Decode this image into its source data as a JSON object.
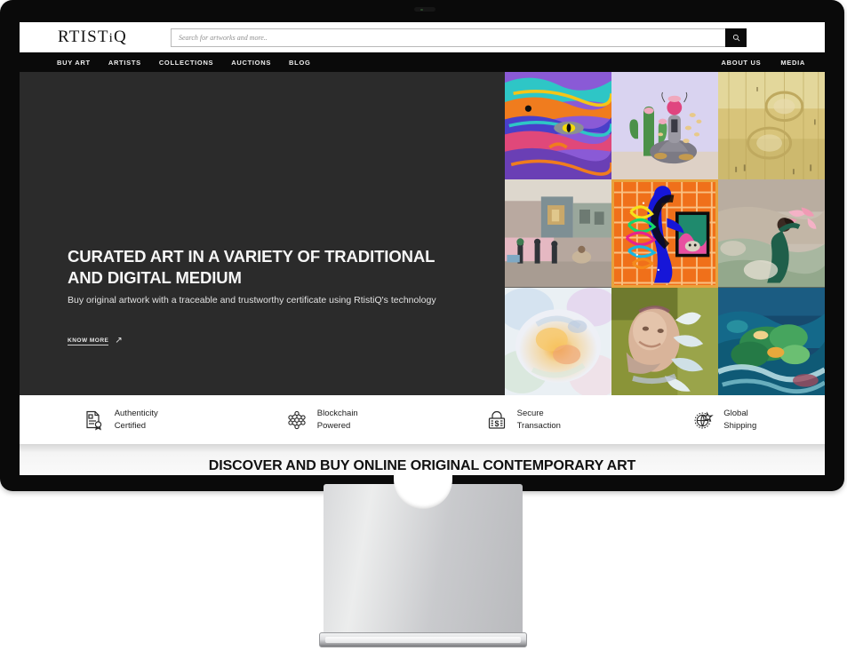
{
  "device": {
    "type": "desktop-monitor",
    "bezel_color": "#0a0a0a",
    "stand_color": "#cfd0d2"
  },
  "header": {
    "logo_main": "RTIST",
    "logo_i": "i",
    "logo_end": "Q",
    "logo_full": "RTISTiQ"
  },
  "search": {
    "placeholder": "Search for artworks and more..",
    "value": "",
    "button_icon": "search-icon"
  },
  "nav": {
    "left_items": [
      {
        "label": "BUY ART"
      },
      {
        "label": "ARTISTS"
      },
      {
        "label": "COLLECTIONS"
      },
      {
        "label": "AUCTIONS"
      },
      {
        "label": "BLOG"
      }
    ],
    "right_items": [
      {
        "label": "ABOUT US"
      },
      {
        "label": "MEDIA"
      }
    ]
  },
  "hero": {
    "background_color": "#2b2b2b",
    "title": "CURATED ART IN A VARIETY OF TRADITIONAL AND DIGITAL MEDIUM",
    "subtitle": "Buy original artwork with a traceable and trustworthy certificate using RtistiQ's technology",
    "cta_label": "KNOW MORE",
    "cta_arrow": "↗"
  },
  "art_grid": {
    "selected_index": 4,
    "selected_border_color": "#e8a33d",
    "tiles": [
      {
        "name": "abstract-psychedelic-cat",
        "alt": "Colorful psychedelic abstract cat face"
      },
      {
        "name": "cactus-figure-painting",
        "alt": "Seated figure with cactus on lilac ground"
      },
      {
        "name": "golden-texture-abstract",
        "alt": "Golden ochre textured abstract with circles"
      },
      {
        "name": "street-scene-photo",
        "alt": "Weathered street scene with figures"
      },
      {
        "name": "orange-grid-blue-figure",
        "alt": "Blue silhouette figure on orange grid"
      },
      {
        "name": "woman-carrying-flowers",
        "alt": "Woman in green dress carrying pink flowers"
      },
      {
        "name": "pastel-floral-abstract",
        "alt": "Soft pastel floral abstract"
      },
      {
        "name": "portrait-green-abstract",
        "alt": "Abstract portrait on olive green"
      },
      {
        "name": "teal-underwater-abstract",
        "alt": "Teal underwater abstract landscape"
      }
    ]
  },
  "features": [
    {
      "icon": "certificate-document-icon",
      "line1": "Authenticity",
      "line2": "Certified"
    },
    {
      "icon": "blockchain-network-icon",
      "line1": "Blockchain",
      "line2": "Powered"
    },
    {
      "icon": "padlock-dollar-icon",
      "line1": "Secure",
      "line2": "Transaction"
    },
    {
      "icon": "globe-airplane-icon",
      "line1": "Global",
      "line2": "Shipping"
    }
  ],
  "lower_section": {
    "title": "DISCOVER AND BUY ONLINE ORIGINAL CONTEMPORARY ART"
  }
}
